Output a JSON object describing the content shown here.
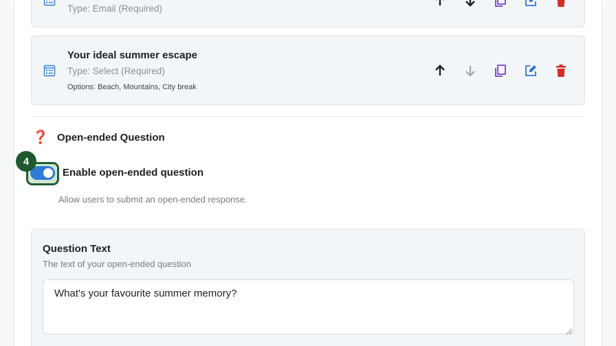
{
  "fields": [
    {
      "title": "",
      "type": "Type: Email (Required)",
      "options": ""
    },
    {
      "title": "Your ideal summer escape",
      "type": "Type: Select (Required)",
      "options": "Options: Beach, Mountains, City break"
    }
  ],
  "field_icon": "form-list-icon",
  "actions": {
    "up_icon": "arrow-up-icon",
    "down_icon": "arrow-down-icon",
    "copy_icon": "copy-icon",
    "edit_icon": "edit-icon",
    "delete_icon": "trash-icon"
  },
  "open_ended": {
    "icon": "question-mark-icon",
    "symbol": "❓",
    "title": "Open-ended Question",
    "step_badge": "4",
    "toggle_label": "Enable open-ended question",
    "toggle_help": "Allow users to submit an open-ended response.",
    "enabled": true
  },
  "question_text": {
    "title": "Question Text",
    "help": "The text of your open-ended question",
    "value": "What's your favourite summer memory?"
  },
  "colors": {
    "accent_blue": "#2e7bd4",
    "copy_purple": "#7b3fc4",
    "delete_red": "#d62b2b",
    "badge_green": "#1f5a2e",
    "disabled_gray": "#9aa0a6"
  }
}
